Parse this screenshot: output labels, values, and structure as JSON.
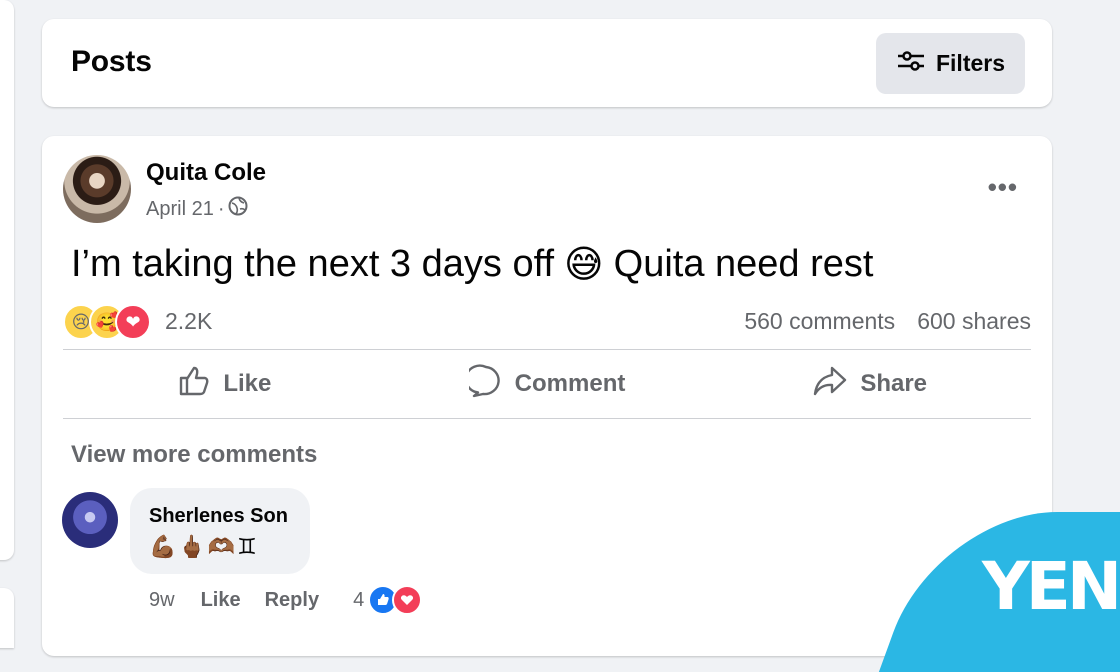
{
  "header": {
    "title": "Posts",
    "filters_label": "Filters"
  },
  "post": {
    "author": "Quita Cole",
    "date": "April 21",
    "date_sep": "·",
    "text_before": "I’m taking the next 3 days off",
    "emoji": "😅",
    "text_after": "Quita need rest",
    "reactions": {
      "icons": [
        "😢",
        "🥰",
        "❤"
      ],
      "count": "2.2K"
    },
    "comments_count": "560 comments",
    "shares_count": "600 shares",
    "actions": {
      "like": "Like",
      "comment": "Comment",
      "share": "Share"
    },
    "more_menu": "•••"
  },
  "comments": {
    "view_more": "View more comments",
    "items": [
      {
        "author": "Sherlenes Son",
        "text": "💪🏾🖕🏾🫶🏾♊",
        "age": "9w",
        "like": "Like",
        "reply": "Reply",
        "reaction_count": "4"
      }
    ]
  },
  "logo": {
    "text": "YEN"
  },
  "colors": {
    "accent_blue": "#1877f2",
    "logo_bg": "#2bb7e4",
    "muted_text": "#65676b"
  }
}
